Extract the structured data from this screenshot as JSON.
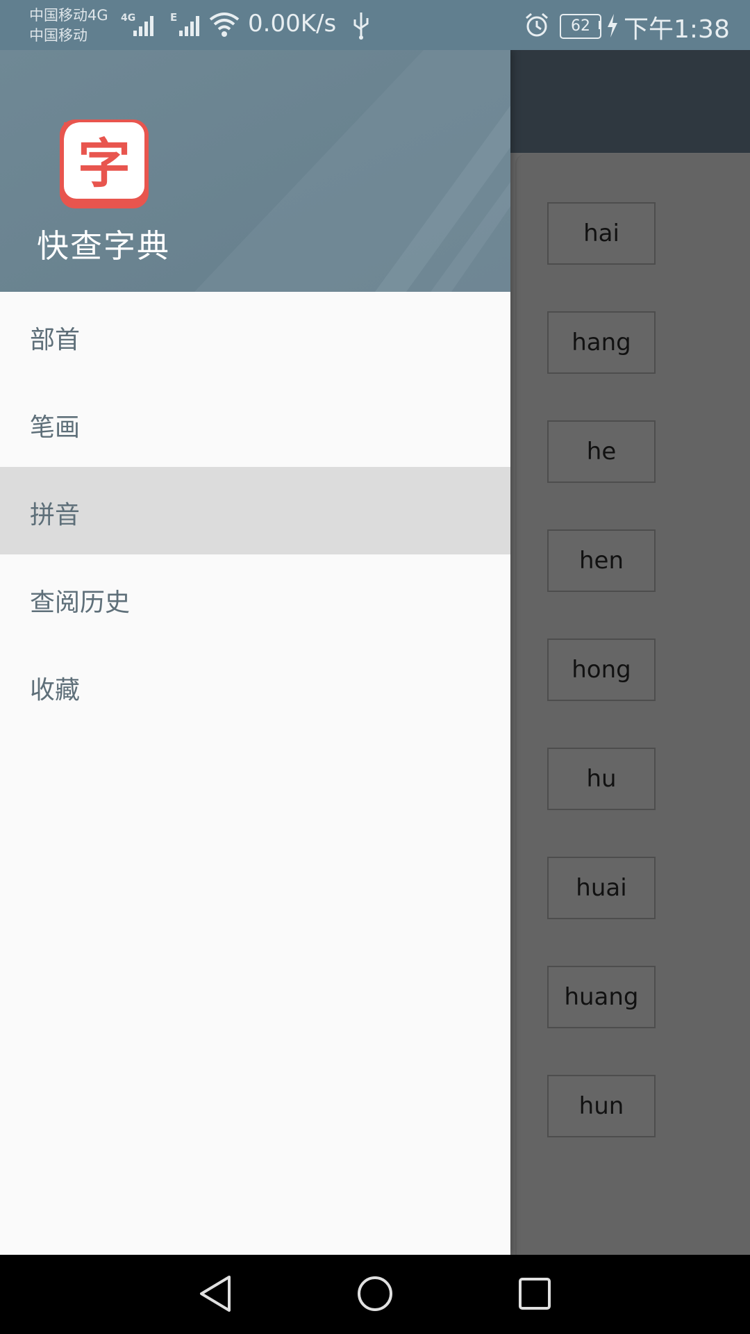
{
  "status_bar": {
    "carrier_line1": "中国移动4G",
    "carrier_line2": "中国移动",
    "net_type_1": "4G",
    "net_type_2": "E",
    "net_speed": "0.00K/s",
    "battery_level": "62",
    "time": "下午1:38"
  },
  "drawer": {
    "app_name": "快查字典",
    "logo_char": "字",
    "items": [
      {
        "label": "部首",
        "active": false
      },
      {
        "label": "笔画",
        "active": false
      },
      {
        "label": "拼音",
        "active": true
      },
      {
        "label": "查阅历史",
        "active": false
      },
      {
        "label": "收藏",
        "active": false
      }
    ]
  },
  "pinyin_list": [
    "hai",
    "hang",
    "he",
    "hen",
    "hong",
    "hu",
    "huai",
    "huang",
    "hun"
  ],
  "colors": {
    "header": "#6a8492",
    "status_bar": "#617f8f",
    "toolbar": "#2f3840",
    "logo_red": "#e8554e",
    "menu_text": "#5e6f79",
    "active_row": "#dcdcdc"
  }
}
